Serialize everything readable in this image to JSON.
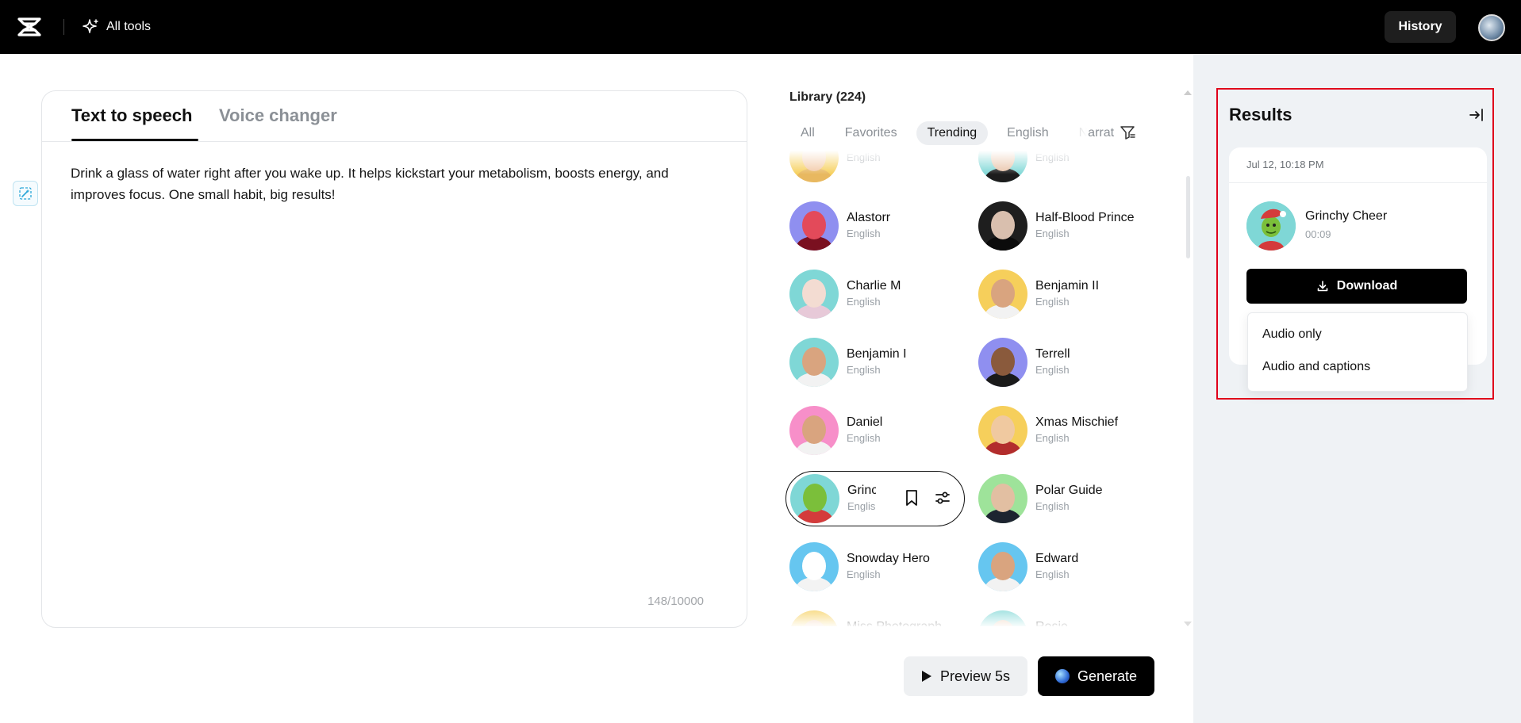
{
  "topbar": {
    "all_tools_label": "All tools",
    "history_label": "History"
  },
  "editor": {
    "tabs": [
      {
        "label": "Text to speech",
        "active": true
      },
      {
        "label": "Voice changer",
        "active": false
      }
    ],
    "text": "Drink a glass of water right after you wake up. It helps kickstart your metabolism, boosts energy, and improves focus. One small habit, big results!",
    "char_count": "148/10000"
  },
  "library": {
    "title": "Library (224)",
    "filters": [
      {
        "label": "All",
        "active": false
      },
      {
        "label": "Favorites",
        "active": false
      },
      {
        "label": "Trending",
        "active": true
      },
      {
        "label": "English",
        "active": false
      },
      {
        "label": "Narrat",
        "active": false
      }
    ],
    "voices": [
      {
        "name": "",
        "language": "English",
        "bg": "#f6cf5b",
        "skin": "#f2c9a6",
        "cloth": "#e8b860"
      },
      {
        "name": "",
        "language": "English",
        "bg": "#7fd7d6",
        "skin": "#e9c4a8",
        "cloth": "#1c1c1c"
      },
      {
        "name": "Alastorr",
        "language": "English",
        "bg": "#8f8ff0",
        "skin": "#e34a5a",
        "cloth": "#7a1020"
      },
      {
        "name": "Half-Blood Prince",
        "language": "English",
        "bg": "#1e1e1e",
        "skin": "#d9bfae",
        "cloth": "#0b0b0b"
      },
      {
        "name": "Charlie M",
        "language": "English",
        "bg": "#7fd7d6",
        "skin": "#f3dcd2",
        "cloth": "#e7c9d8"
      },
      {
        "name": "Benjamin II",
        "language": "English",
        "bg": "#f6cf5b",
        "skin": "#d9a47f",
        "cloth": "#f2f2f2"
      },
      {
        "name": "Benjamin I",
        "language": "English",
        "bg": "#7fd7d6",
        "skin": "#d9a47f",
        "cloth": "#f2f2f2"
      },
      {
        "name": "Terrell",
        "language": "English",
        "bg": "#8f8ff0",
        "skin": "#8a5a3c",
        "cloth": "#1a1a1a"
      },
      {
        "name": "Daniel",
        "language": "English",
        "bg": "#f78fc9",
        "skin": "#d9a47f",
        "cloth": "#f2f2f2"
      },
      {
        "name": "Xmas Mischief",
        "language": "English",
        "bg": "#f6cf5b",
        "skin": "#f0c9a0",
        "cloth": "#b22d2d"
      },
      {
        "name": "Grinchy Cheer",
        "language": "English",
        "bg": "#7fd7d6",
        "skin": "#7bbf3a",
        "cloth": "#d43b3b",
        "selected": true
      },
      {
        "name": "Polar Guide",
        "language": "English",
        "bg": "#9ee39a",
        "skin": "#e2bfa2",
        "cloth": "#1d2430"
      },
      {
        "name": "Snowday Hero",
        "language": "English",
        "bg": "#66c6f0",
        "skin": "#ffffff",
        "cloth": "#f3f3f3"
      },
      {
        "name": "Edward",
        "language": "English",
        "bg": "#66c6f0",
        "skin": "#d9a47f",
        "cloth": "#f2f2f2"
      },
      {
        "name": "Miss Photograph",
        "language": "English",
        "bg": "#f6cf5b",
        "skin": "#f2c9a6",
        "cloth": "#e0e0e0"
      },
      {
        "name": "Rosie",
        "language": "English",
        "bg": "#7fd7d6",
        "skin": "#e9c4a8",
        "cloth": "#e0e0e0"
      }
    ]
  },
  "actions": {
    "preview_label": "Preview 5s",
    "generate_label": "Generate"
  },
  "results": {
    "title": "Results",
    "item": {
      "date": "Jul 12, 10:18 PM",
      "name": "Grinchy Cheer",
      "duration": "00:09",
      "download_label": "Download",
      "download_options": [
        "Audio only",
        "Audio and captions"
      ]
    }
  },
  "colors": {
    "accent": "#000000",
    "highlight_box": "#e0001b",
    "panel_bg": "#eff2f5"
  }
}
